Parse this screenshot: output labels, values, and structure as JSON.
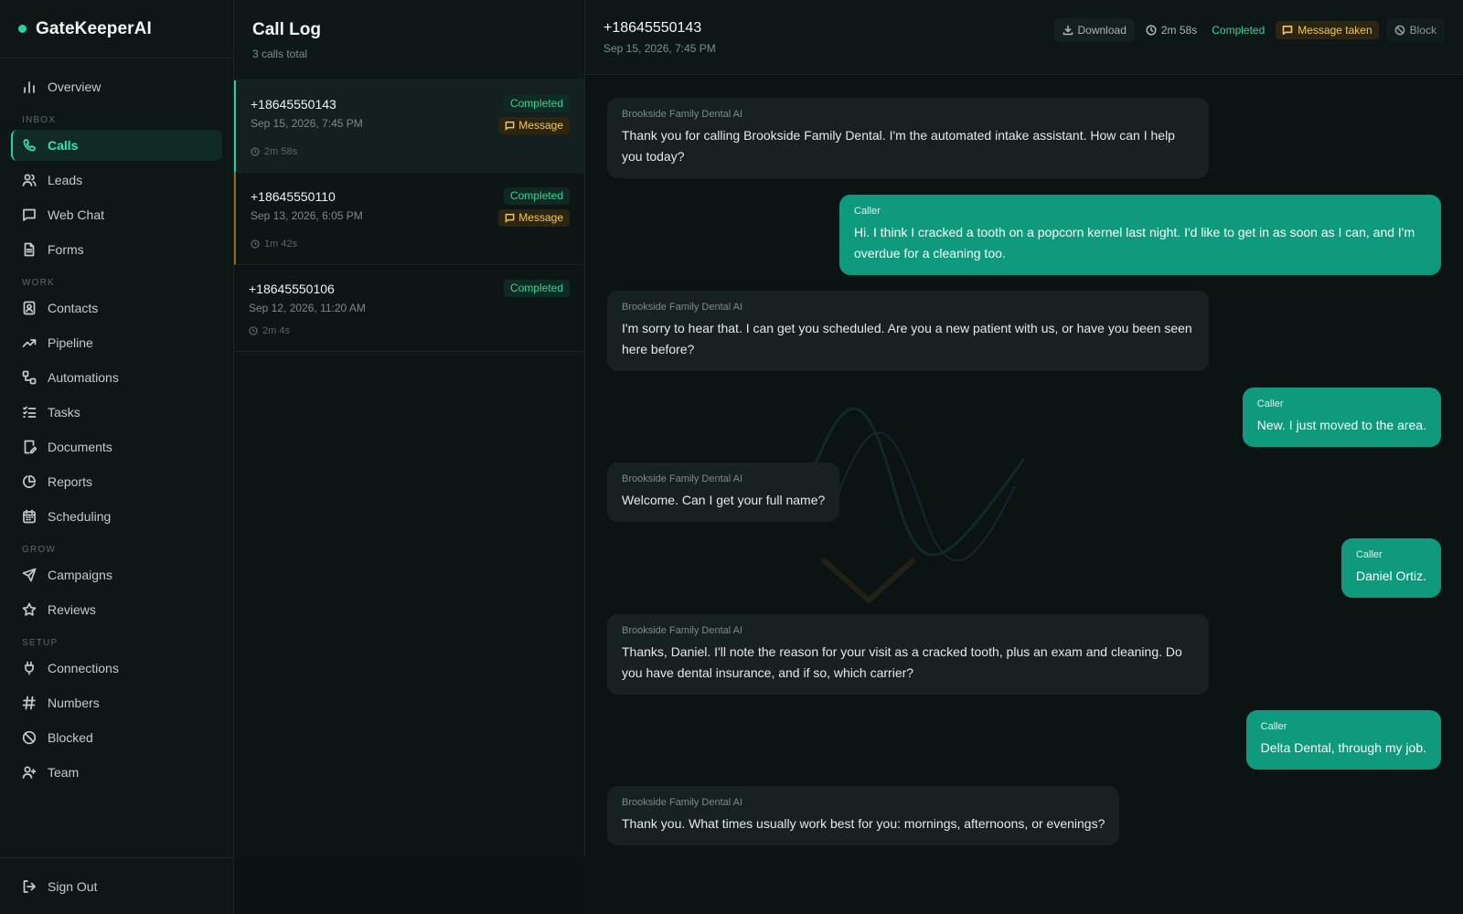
{
  "brand": {
    "name": "GateKeeperAI",
    "accent": "#22d3a5"
  },
  "nav": {
    "overview": {
      "label": "Overview",
      "icon": "bar-chart-icon"
    },
    "sections": {
      "inbox": "INBOX",
      "work": "WORK",
      "grow": "GROW",
      "setup": "SETUP"
    },
    "inbox": [
      {
        "label": "Calls",
        "icon": "phone-icon",
        "active": true
      },
      {
        "label": "Leads",
        "icon": "users-icon"
      },
      {
        "label": "Web Chat",
        "icon": "chat-icon"
      },
      {
        "label": "Forms",
        "icon": "document-icon"
      }
    ],
    "work": [
      {
        "label": "Contacts",
        "icon": "contact-card-icon"
      },
      {
        "label": "Pipeline",
        "icon": "trending-up-icon"
      },
      {
        "label": "Automations",
        "icon": "workflow-icon"
      },
      {
        "label": "Tasks",
        "icon": "list-check-icon"
      },
      {
        "label": "Documents",
        "icon": "file-edit-icon"
      },
      {
        "label": "Reports",
        "icon": "pie-chart-icon"
      },
      {
        "label": "Scheduling",
        "icon": "calendar-icon"
      }
    ],
    "grow": [
      {
        "label": "Campaigns",
        "icon": "send-icon"
      },
      {
        "label": "Reviews",
        "icon": "star-icon"
      }
    ],
    "setup": [
      {
        "label": "Connections",
        "icon": "plug-icon"
      },
      {
        "label": "Numbers",
        "icon": "hash-icon"
      },
      {
        "label": "Blocked",
        "icon": "ban-icon"
      },
      {
        "label": "Team",
        "icon": "user-plus-icon"
      }
    ],
    "signout": {
      "label": "Sign Out",
      "icon": "logout-icon"
    }
  },
  "call_log": {
    "title": "Call Log",
    "subtitle": "3 calls total",
    "calls": [
      {
        "number": "+18645550143",
        "date": "Sep 15, 2026, 7:45 PM",
        "duration": "2m 58s",
        "status": "Completed",
        "message": "Message"
      },
      {
        "number": "+18645550110",
        "date": "Sep 13, 2026, 6:05 PM",
        "duration": "1m 42s",
        "status": "Completed",
        "message": "Message"
      },
      {
        "number": "+18645550106",
        "date": "Sep 12, 2026, 11:20 AM",
        "duration": "2m 4s",
        "status": "Completed"
      }
    ]
  },
  "detail": {
    "number": "+18645550143",
    "date": "Sep 15, 2026, 7:45 PM",
    "actions": {
      "download": "Download",
      "duration": "2m 58s",
      "status": "Completed",
      "message": "Message taken",
      "block": "Block"
    },
    "transcript": [
      {
        "speaker": "Brookside Family Dental AI",
        "role": "ai",
        "text": "Thank you for calling Brookside Family Dental. I'm the automated intake assistant. How can I help you today?"
      },
      {
        "speaker": "Caller",
        "role": "caller",
        "text": "Hi. I think I cracked a tooth on a popcorn kernel last night. I'd like to get in as soon as I can, and I'm overdue for a cleaning too."
      },
      {
        "speaker": "Brookside Family Dental AI",
        "role": "ai",
        "text": "I'm sorry to hear that. I can get you scheduled. Are you a new patient with us, or have you been seen here before?"
      },
      {
        "speaker": "Caller",
        "role": "caller",
        "text": "New. I just moved to the area."
      },
      {
        "speaker": "Brookside Family Dental AI",
        "role": "ai",
        "text": "Welcome. Can I get your full name?"
      },
      {
        "speaker": "Caller",
        "role": "caller",
        "text": "Daniel Ortiz."
      },
      {
        "speaker": "Brookside Family Dental AI",
        "role": "ai",
        "text": "Thanks, Daniel. I'll note the reason for your visit as a cracked tooth, plus an exam and cleaning. Do you have dental insurance, and if so, which carrier?"
      },
      {
        "speaker": "Caller",
        "role": "caller",
        "text": "Delta Dental, through my job."
      },
      {
        "speaker": "Brookside Family Dental AI",
        "role": "ai",
        "text": "Thank you. What times usually work best for you: mornings, afternoons, or evenings?"
      }
    ]
  }
}
